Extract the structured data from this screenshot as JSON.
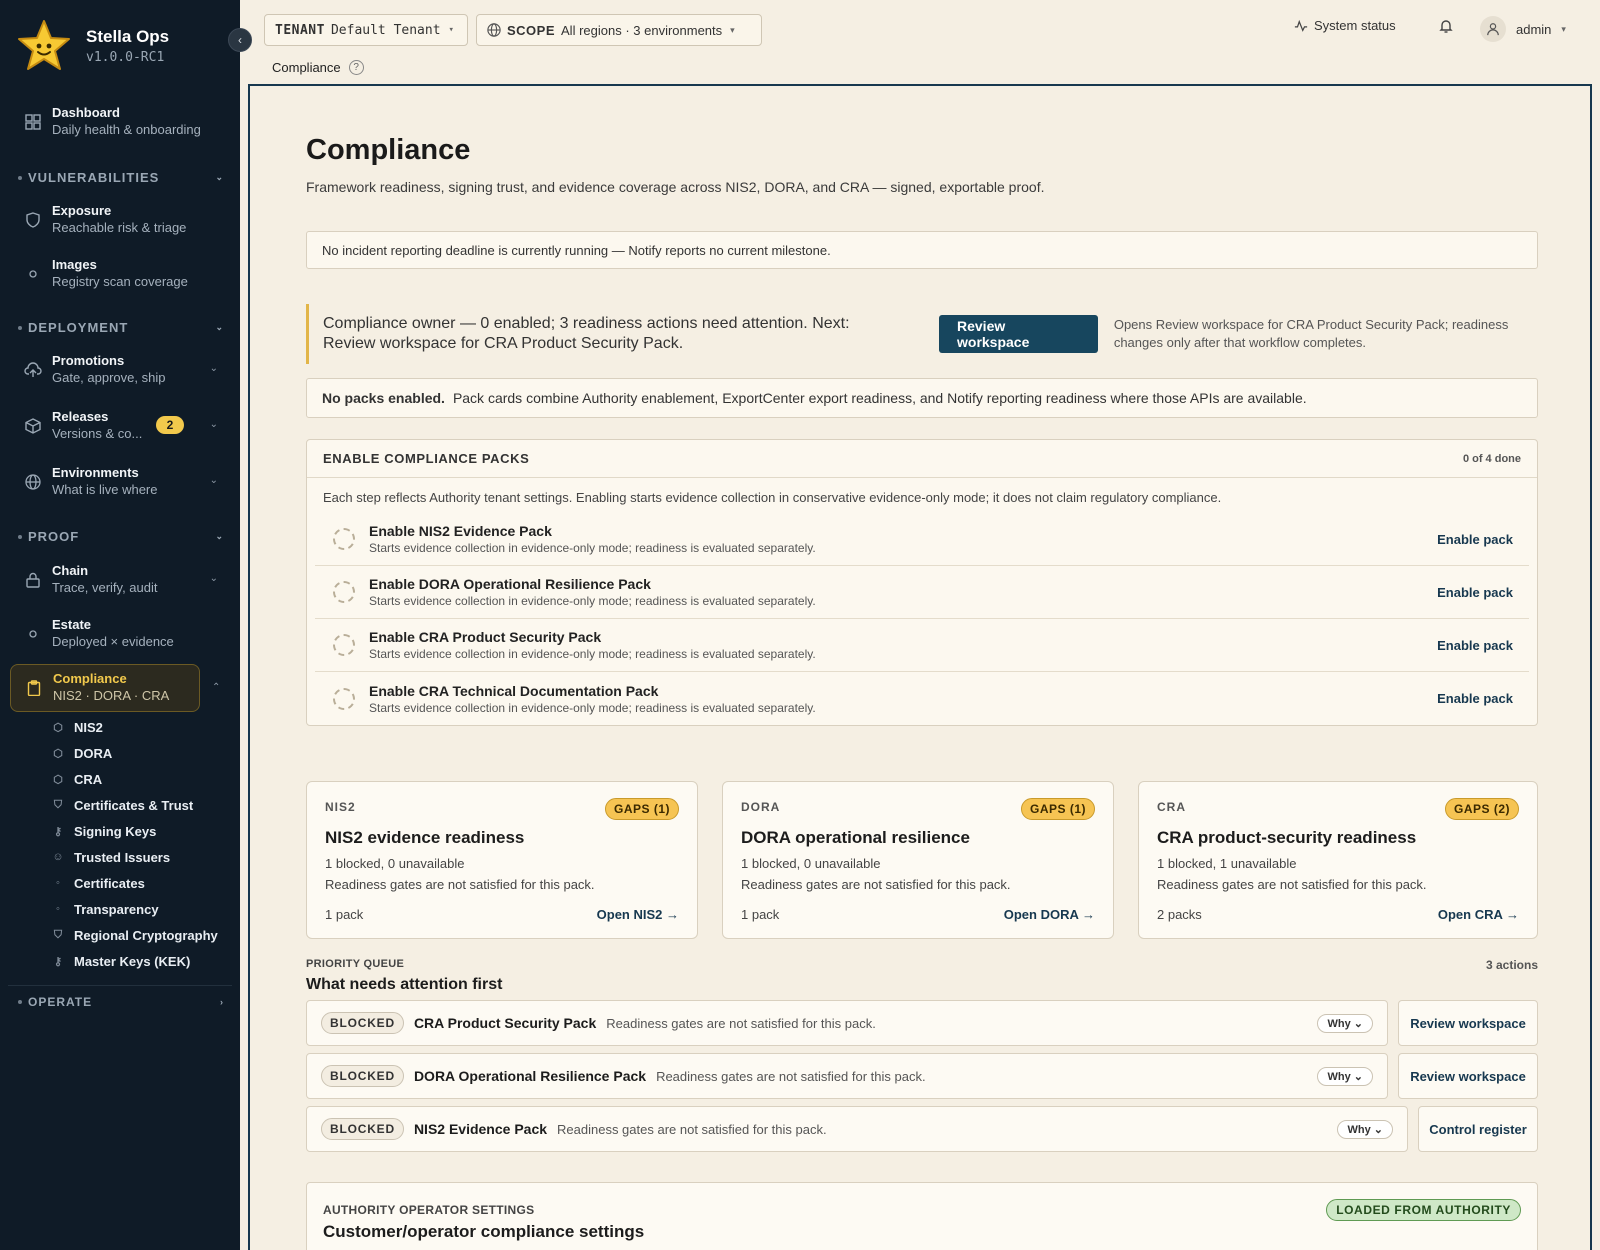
{
  "app": {
    "name": "Stella Ops",
    "version": "v1.0.0-RC1"
  },
  "sidebar": {
    "dashboard": {
      "title": "Dashboard",
      "sub": "Daily health & onboarding"
    },
    "sections": {
      "vulnerabilities": "VULNERABILITIES",
      "deployment": "DEPLOYMENT",
      "proof": "PROOF",
      "operate": "OPERATE"
    },
    "exposure": {
      "title": "Exposure",
      "sub": "Reachable risk & triage"
    },
    "images": {
      "title": "Images",
      "sub": "Registry scan coverage"
    },
    "promotions": {
      "title": "Promotions",
      "sub": "Gate, approve, ship"
    },
    "releases": {
      "title": "Releases",
      "sub": "Versions & co...",
      "badge": "2"
    },
    "environments": {
      "title": "Environments",
      "sub": "What is live where"
    },
    "chain": {
      "title": "Chain",
      "sub": "Trace, verify, audit"
    },
    "estate": {
      "title": "Estate",
      "sub": "Deployed × evidence"
    },
    "compliance": {
      "title": "Compliance",
      "sub": "NIS2 · DORA · CRA"
    },
    "compliance_children": [
      "NIS2",
      "DORA",
      "CRA",
      "Certificates & Trust",
      "Signing Keys",
      "Trusted Issuers",
      "Certificates",
      "Transparency",
      "Regional Cryptography",
      "Master Keys (KEK)"
    ]
  },
  "topbar": {
    "tenant_label": "TENANT",
    "tenant_value": "Default Tenant",
    "scope_label": "SCOPE",
    "scope_value": "All regions · 3 environments",
    "system_status": "System status",
    "user": "admin"
  },
  "breadcrumb": "Compliance",
  "page": {
    "title": "Compliance",
    "subtitle": "Framework readiness, signing trust, and evidence coverage across NIS2, DORA, and CRA — signed, exportable proof.",
    "incident_notice": "No incident reporting deadline is currently running — Notify reports no current milestone.",
    "owner_text": "Compliance owner — 0 enabled; 3 readiness actions need attention. Next: Review workspace for CRA Product Security Pack.",
    "owner_button": "Review workspace",
    "owner_note": "Opens Review workspace for CRA Product Security Pack; readiness changes only after that workflow completes.",
    "no_packs_bold": "No packs enabled.",
    "no_packs_text": "Pack cards combine Authority enablement, ExportCenter export readiness, and Notify reporting readiness where those APIs are available."
  },
  "packs": {
    "header": "ENABLE COMPLIANCE PACKS",
    "done": "0 of 4 done",
    "desc": "Each step reflects Authority tenant settings. Enabling starts evidence collection in conservative evidence-only mode; it does not claim regulatory compliance.",
    "items": [
      {
        "title": "Enable NIS2 Evidence Pack",
        "sub": "Starts evidence collection in evidence-only mode; readiness is evaluated separately.",
        "action": "Enable pack"
      },
      {
        "title": "Enable DORA Operational Resilience Pack",
        "sub": "Starts evidence collection in evidence-only mode; readiness is evaluated separately.",
        "action": "Enable pack"
      },
      {
        "title": "Enable CRA Product Security Pack",
        "sub": "Starts evidence collection in evidence-only mode; readiness is evaluated separately.",
        "action": "Enable pack"
      },
      {
        "title": "Enable CRA Technical Documentation Pack",
        "sub": "Starts evidence collection in evidence-only mode; readiness is evaluated separately.",
        "action": "Enable pack"
      }
    ]
  },
  "frameworks": [
    {
      "code": "NIS2",
      "gap": "GAPS (1)",
      "title": "NIS2 evidence readiness",
      "line1": "1 blocked, 0 unavailable",
      "line2": "Readiness gates are not satisfied for this pack.",
      "packs": "1 pack",
      "link": "Open NIS2 →"
    },
    {
      "code": "DORA",
      "gap": "GAPS (1)",
      "title": "DORA operational resilience",
      "line1": "1 blocked, 0 unavailable",
      "line2": "Readiness gates are not satisfied for this pack.",
      "packs": "1 pack",
      "link": "Open DORA →"
    },
    {
      "code": "CRA",
      "gap": "GAPS (2)",
      "title": "CRA product-security readiness",
      "line1": "1 blocked, 1 unavailable",
      "line2": "Readiness gates are not satisfied for this pack.",
      "packs": "2 packs",
      "link": "Open CRA →"
    }
  ],
  "priority": {
    "label": "PRIORITY QUEUE",
    "title": "What needs attention first",
    "count": "3 actions",
    "rows": [
      {
        "tag": "BLOCKED",
        "name": "CRA Product Security Pack",
        "desc": "Readiness gates are not satisfied for this pack.",
        "why": "Why",
        "action": "Review workspace"
      },
      {
        "tag": "BLOCKED",
        "name": "DORA Operational Resilience Pack",
        "desc": "Readiness gates are not satisfied for this pack.",
        "why": "Why",
        "action": "Review workspace"
      },
      {
        "tag": "BLOCKED",
        "name": "NIS2 Evidence Pack",
        "desc": "Readiness gates are not satisfied for this pack.",
        "why": "Why",
        "action": "Control register"
      }
    ]
  },
  "authority": {
    "label": "AUTHORITY OPERATOR SETTINGS",
    "title": "Customer/operator compliance settings",
    "badge": "LOADED FROM AUTHORITY"
  },
  "colors": {
    "sidebar_bg": "#0f1b27",
    "page_bg": "#f5efe3",
    "accent": "#17465e",
    "highlight": "#f2c94c"
  }
}
